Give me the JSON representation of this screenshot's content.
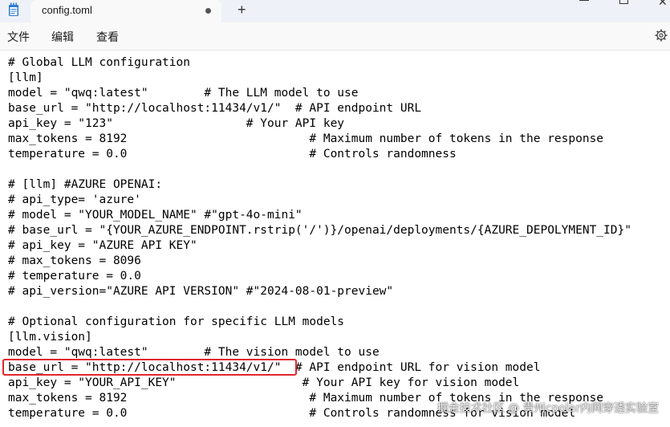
{
  "window": {
    "tab_title": "config.toml",
    "new_tab_symbol": "+",
    "close_symbol": "✕"
  },
  "menu": {
    "file": "文件",
    "edit": "编辑",
    "view": "查看"
  },
  "editor": {
    "lines": [
      "# Global LLM configuration",
      "[llm]",
      "model = \"qwq:latest\"        # The LLM model to use",
      "base_url = \"http://localhost:11434/v1/\"  # API endpoint URL",
      "api_key = \"123\"                   # Your API key",
      "max_tokens = 8192                          # Maximum number of tokens in the response",
      "temperature = 0.0                          # Controls randomness",
      "",
      "# [llm] #AZURE OPENAI:",
      "# api_type= 'azure'",
      "# model = \"YOUR_MODEL_NAME\" #\"gpt-4o-mini\"",
      "# base_url = \"{YOUR_AZURE_ENDPOINT.rstrip('/')}/openai/deployments/{AZURE_DEPOLYMENT_ID}\"",
      "# api_key = \"AZURE API KEY\"",
      "# max_tokens = 8096",
      "# temperature = 0.0",
      "# api_version=\"AZURE API VERSION\" #\"2024-08-01-preview\"",
      "",
      "# Optional configuration for specific LLM models",
      "[llm.vision]",
      "model = \"qwq:latest\"        # The vision model to use",
      "base_url = \"http://localhost:11434/v1/\"  # API endpoint URL for vision model",
      "api_key = \"YOUR_API_KEY\"                  # Your API key for vision model",
      "max_tokens = 8192                          # Maximum number of tokens in the response",
      "temperature = 0.0                          # Controls randomness for vision model"
    ]
  },
  "watermark": "掘金技术社区 @ 贵州cpolar内网穿透实验室",
  "colors": {
    "highlight": "#e0282e",
    "titlebar": "#eef1f7"
  }
}
